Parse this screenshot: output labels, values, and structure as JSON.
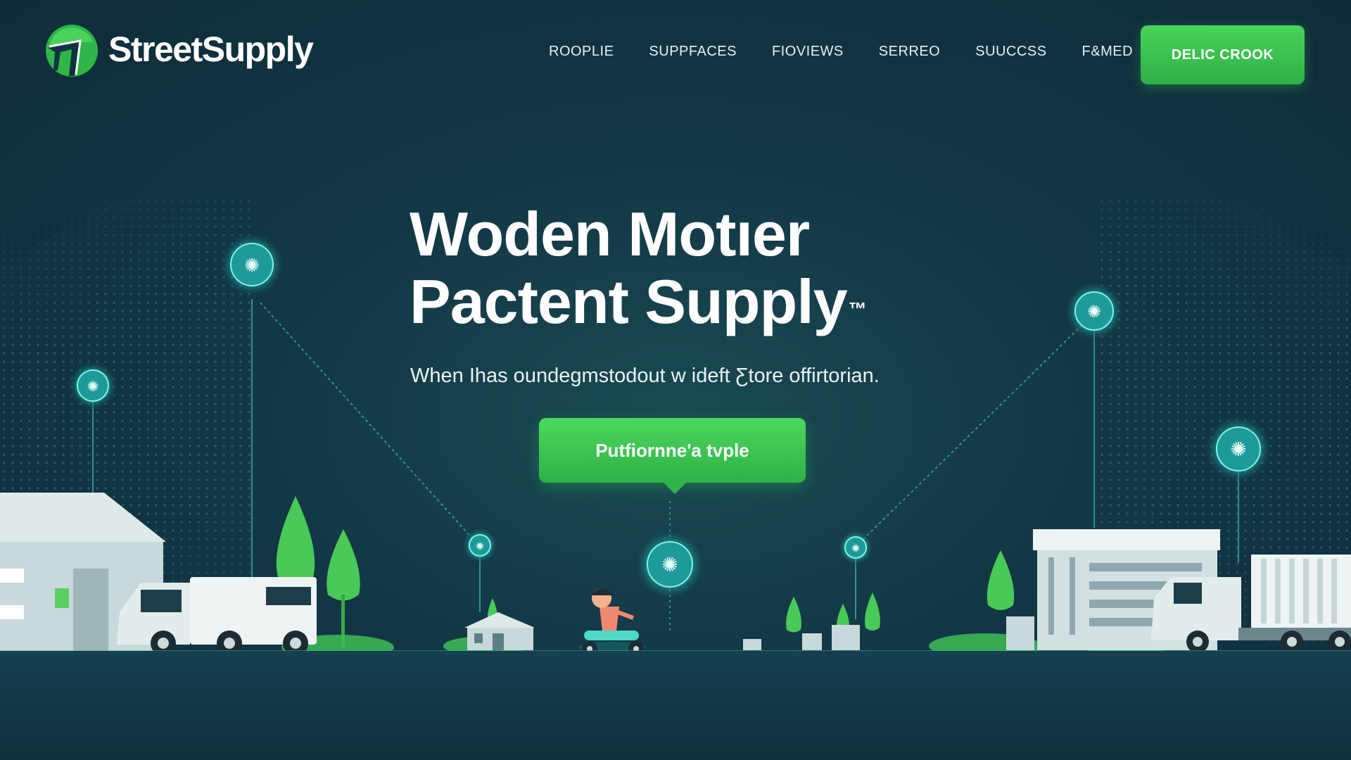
{
  "brand": {
    "name": "StreetSupply"
  },
  "nav": {
    "items": [
      "ROOPLIE",
      "SUPPFACES",
      "FIOVIEWS",
      "SERREO",
      "SUUCCSS",
      "F&MED"
    ]
  },
  "header": {
    "cta_label": "DELIC CROOK"
  },
  "hero": {
    "title_line1": "Woden Motıer",
    "title_line2": "Pactent Supply",
    "trademark": "™",
    "subtitle": "When Ihas oundegmstodout w ideft Ƹtore offirtorian.",
    "cta_label": "Putfiornne'a tvple"
  },
  "colors": {
    "background": "#113240",
    "accent_green": "#3cc652",
    "glow_cyan": "#3fe0d0"
  },
  "icons": {
    "logo": "streetsupply-logo-icon",
    "node": "glowing-node-icon",
    "truck": "delivery-truck-icon",
    "warehouse": "warehouse-icon",
    "scooter": "scooter-rider-icon",
    "tree": "tree-icon"
  }
}
